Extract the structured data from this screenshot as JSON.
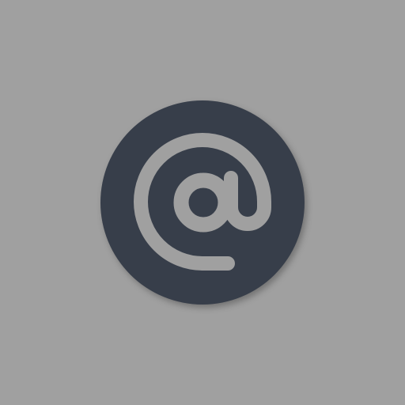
{
  "icon": {
    "name": "at-sign-icon",
    "glyph": "@"
  },
  "colors": {
    "background": "#a0a0a0",
    "disc": "#373e4a",
    "glyph": "#a0a0a0"
  }
}
